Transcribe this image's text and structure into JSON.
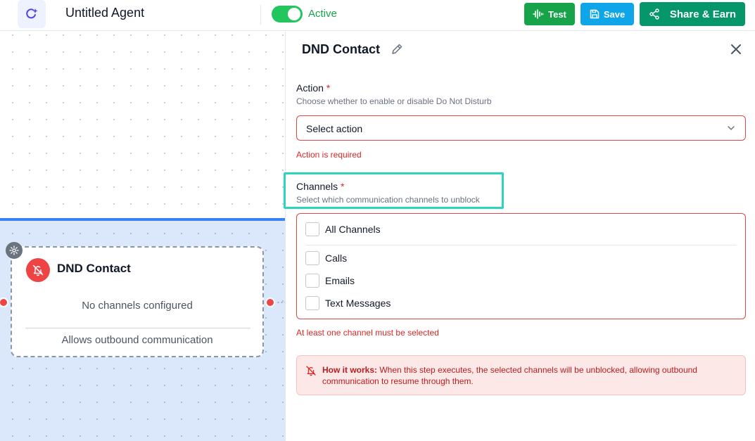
{
  "header": {
    "agent_title": "Untitled Agent",
    "status_label": "Active",
    "test_label": "Test",
    "save_label": "Save",
    "share_label": "Share & Earn"
  },
  "canvas": {
    "node": {
      "title": "DND Contact",
      "message": "No channels configured",
      "footer": "Allows outbound communication"
    }
  },
  "panel": {
    "title": "DND Contact",
    "action": {
      "label": "Action",
      "required_mark": "*",
      "help": "Choose whether to enable or disable Do Not Disturb",
      "select_value": "Select action",
      "error": "Action is required"
    },
    "channels": {
      "label": "Channels",
      "required_mark": "*",
      "help": "Select which communication channels to unblock",
      "all_label": "All Channels",
      "options": [
        "Calls",
        "Emails",
        "Text Messages"
      ],
      "error": "At least one channel must be selected"
    },
    "info": {
      "heading": "How it works:",
      "body": "When this step executes, the selected channels will be unblocked, allowing outbound communication to resume through them."
    }
  },
  "colors": {
    "accent_green": "#16a34a",
    "accent_blue": "#0ea5e9",
    "share_green": "#059669",
    "error_red": "#dc2626",
    "highlight_teal": "#2dd4bf"
  }
}
